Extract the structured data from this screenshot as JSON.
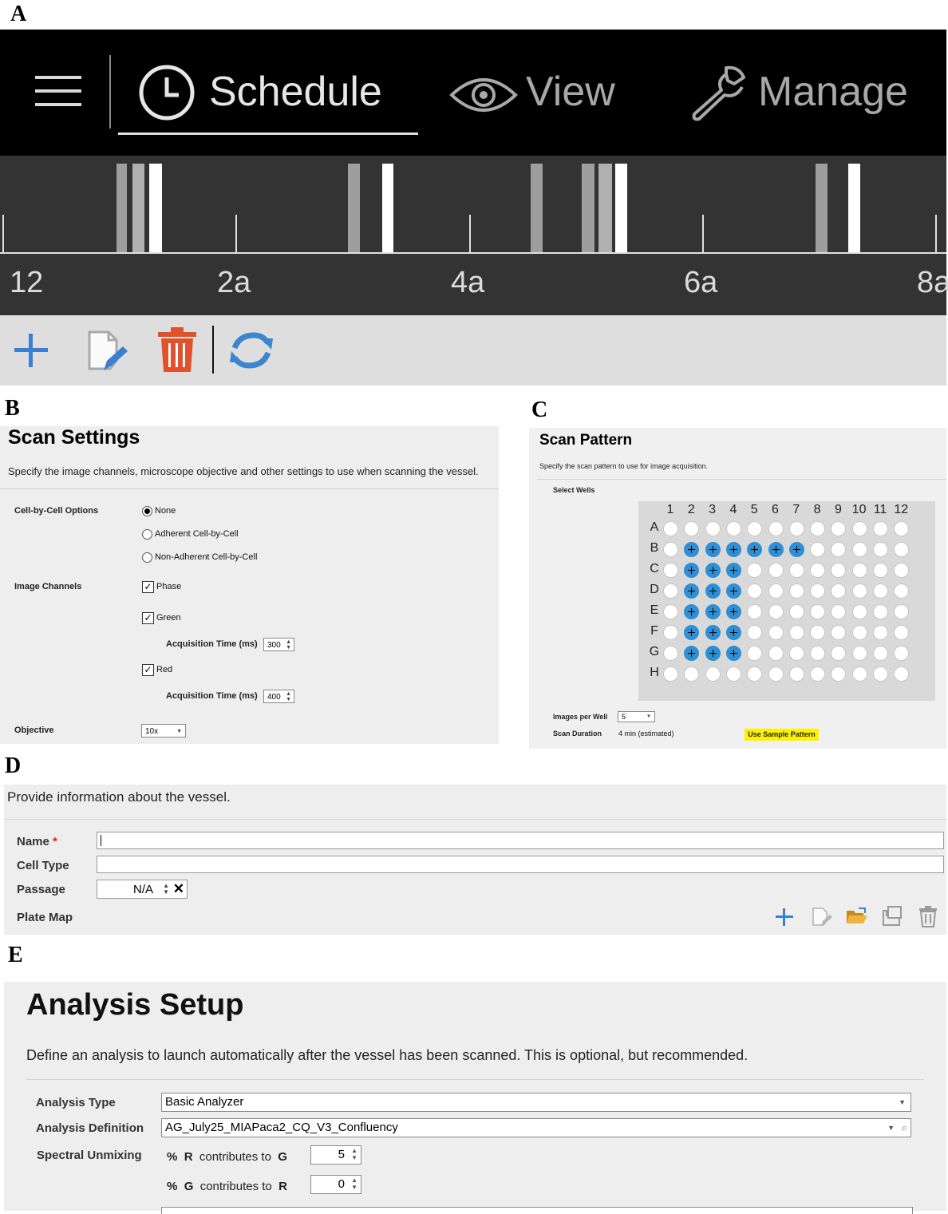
{
  "panel_letters": {
    "a": "A",
    "b": "B",
    "c": "C",
    "d": "D",
    "e": "E"
  },
  "navbar": {
    "tabs": [
      {
        "label": "Schedule",
        "icon": "clock-icon",
        "active": true
      },
      {
        "label": "View",
        "icon": "eye-icon",
        "active": false
      },
      {
        "label": "Manage",
        "icon": "wrench-icon",
        "active": false
      }
    ]
  },
  "timeline": {
    "labels": [
      "12",
      "2a",
      "4a",
      "6a",
      "8a"
    ]
  },
  "toolbar_a": {
    "icons": [
      "add-icon",
      "edit-icon",
      "delete-icon",
      "refresh-icon"
    ],
    "colors": {
      "add": "#3b7fd0",
      "delete": "#e0522c",
      "refresh": "#3b86cc"
    }
  },
  "scan_settings": {
    "title": "Scan Settings",
    "description": "Specify the image channels, microscope objective and other settings to use when scanning the vessel.",
    "cell_by_cell": {
      "label": "Cell-by-Cell Options",
      "options": [
        {
          "label": "None",
          "checked": true
        },
        {
          "label": "Adherent Cell-by-Cell",
          "checked": false
        },
        {
          "label": "Non-Adherent Cell-by-Cell",
          "checked": false
        }
      ]
    },
    "image_channels": {
      "label": "Image Channels",
      "phase": {
        "label": "Phase",
        "checked": true
      },
      "green": {
        "label": "Green",
        "checked": true,
        "acq_label": "Acquisition Time (ms)",
        "acq_value": "300"
      },
      "red": {
        "label": "Red",
        "checked": true,
        "acq_label": "Acquisition Time (ms)",
        "acq_value": "400"
      }
    },
    "objective": {
      "label": "Objective",
      "value": "10x"
    }
  },
  "scan_pattern": {
    "title": "Scan Pattern",
    "description": "Specify the scan pattern to use for image acquisition.",
    "select_wells_label": "Select Wells",
    "columns": [
      "1",
      "2",
      "3",
      "4",
      "5",
      "6",
      "7",
      "8",
      "9",
      "10",
      "11",
      "12"
    ],
    "rows": [
      "A",
      "B",
      "C",
      "D",
      "E",
      "F",
      "G",
      "H"
    ],
    "selected_wells": [
      "B2",
      "B3",
      "B4",
      "B5",
      "B6",
      "B7",
      "C2",
      "C3",
      "C4",
      "D2",
      "D3",
      "D4",
      "E2",
      "E3",
      "E4",
      "F2",
      "F3",
      "F4",
      "G2",
      "G3",
      "G4"
    ],
    "selected_color": "#2f8fd4",
    "images_per_well": {
      "label": "Images per Well",
      "value": "5"
    },
    "scan_duration": {
      "label": "Scan Duration",
      "value": "4 min (estimated)"
    },
    "sample_button": "Use Sample Pattern"
  },
  "vessel_info": {
    "description": "Provide information about the vessel.",
    "name": {
      "label": "Name",
      "required_mark": "*",
      "value": ""
    },
    "cell_type": {
      "label": "Cell Type",
      "value": ""
    },
    "passage": {
      "label": "Passage",
      "value": "N/A"
    },
    "plate_map": {
      "label": "Plate Map",
      "icons": [
        "add-icon",
        "edit-icon",
        "open-folder-icon",
        "save-icon",
        "delete-icon"
      ]
    }
  },
  "analysis_setup": {
    "title": "Analysis Setup",
    "description": "Define an analysis to launch automatically after the vessel has been scanned.  This is optional, but recommended.",
    "analysis_type": {
      "label": "Analysis Type",
      "value": "Basic Analyzer"
    },
    "analysis_definition": {
      "label": "Analysis Definition",
      "value": "AG_July25_MIAPaca2_CQ_V3_Confluency"
    },
    "spectral_unmixing": {
      "label": "Spectral Unmixing",
      "rows": [
        {
          "pct": "%",
          "from": "R",
          "mid": "contributes to",
          "to": "G",
          "value": "5"
        },
        {
          "pct": "%",
          "from": "G",
          "mid": "contributes to",
          "to": "R",
          "value": "0"
        }
      ]
    }
  }
}
